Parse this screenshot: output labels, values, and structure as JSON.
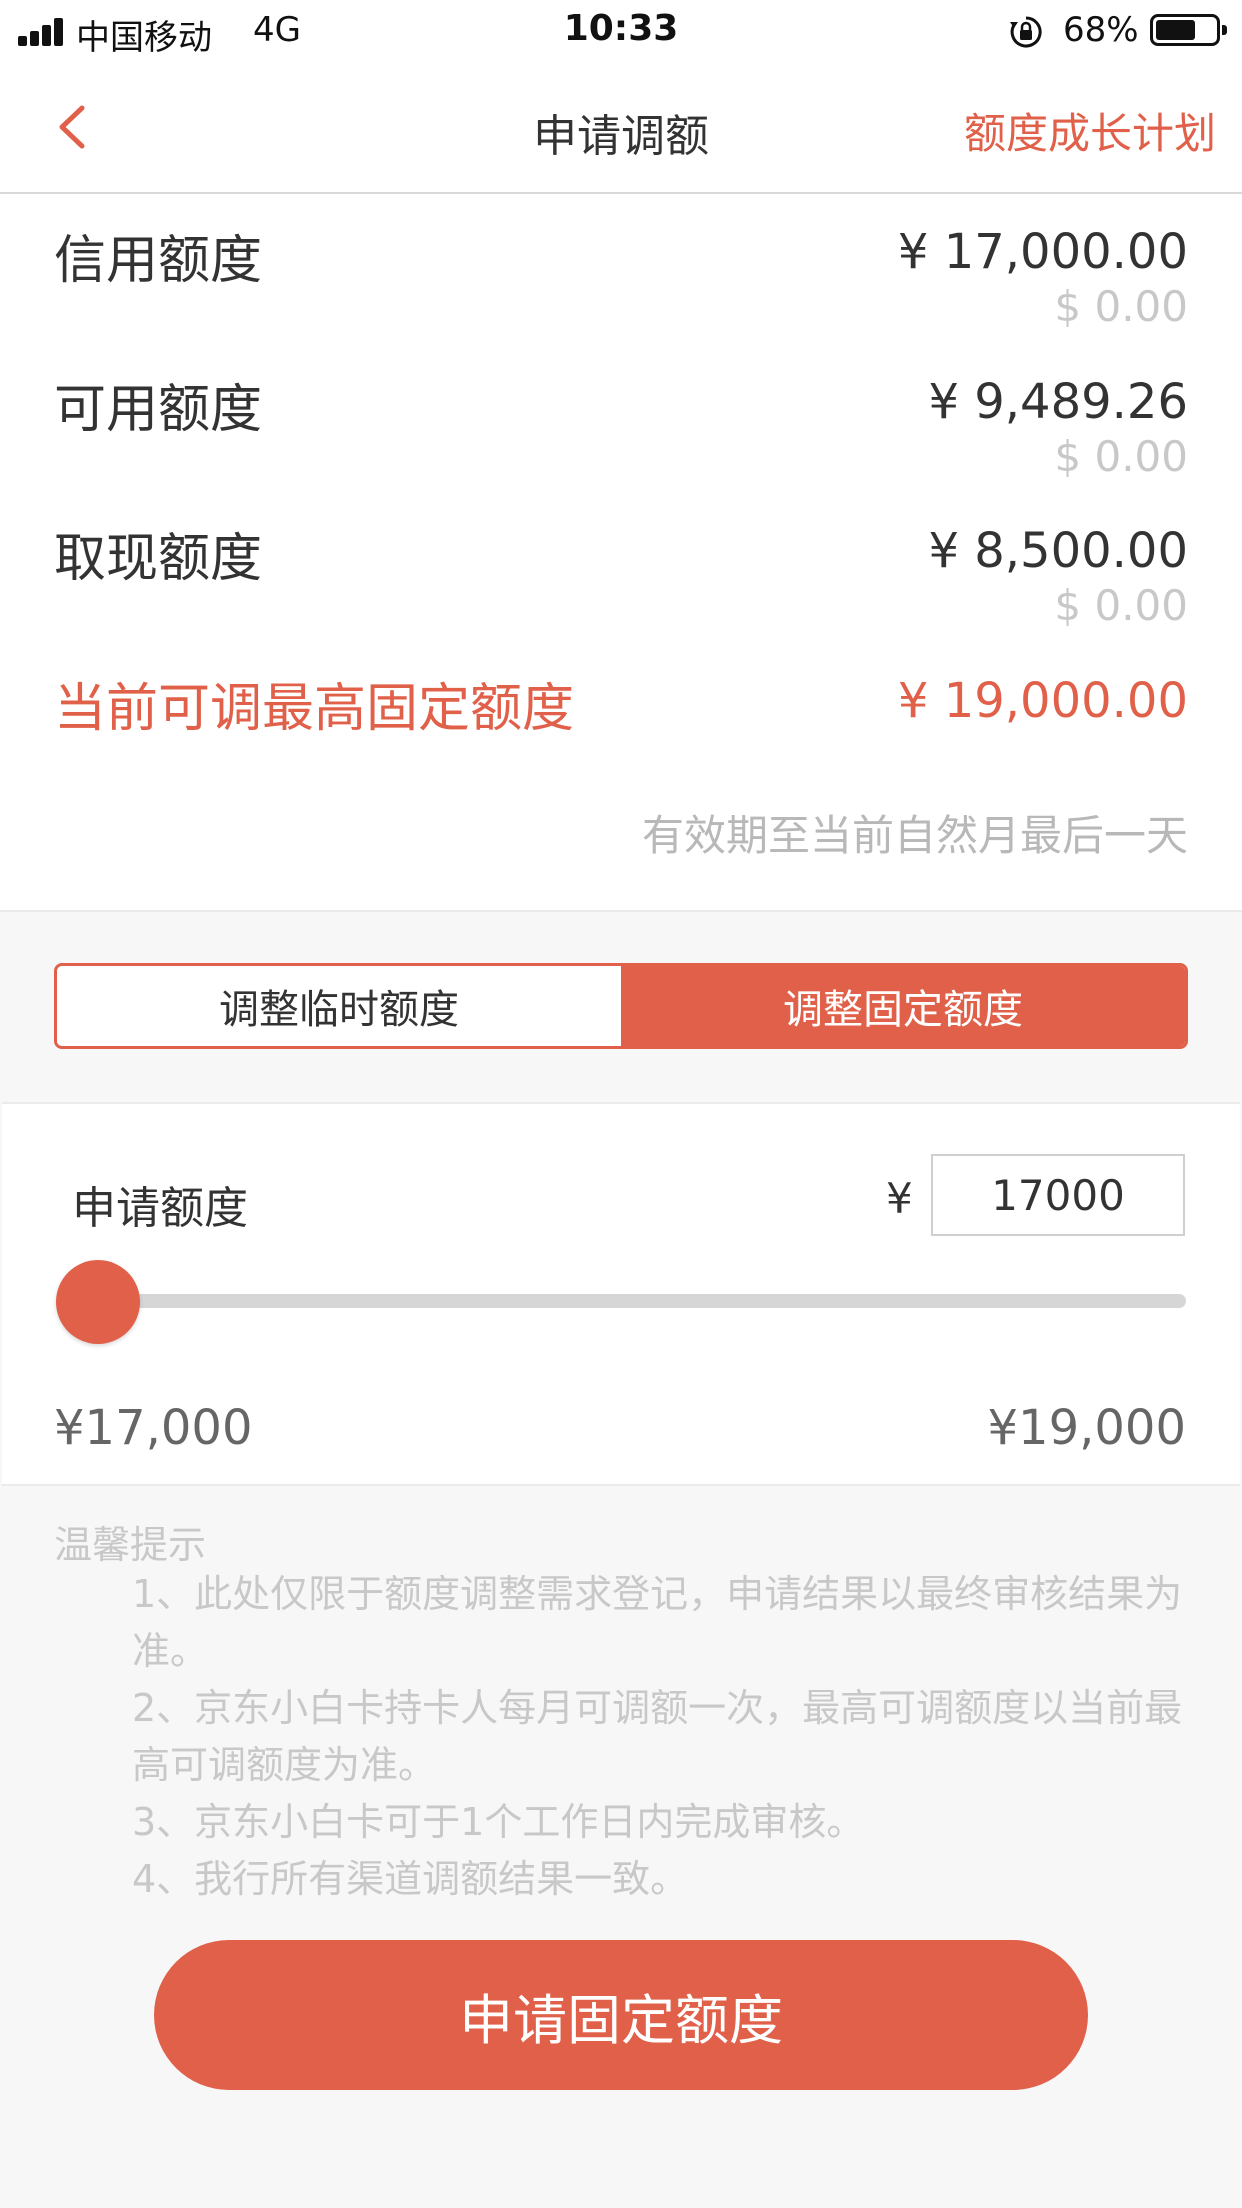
{
  "status_bar": {
    "carrier": "中国移动",
    "network": "4G",
    "time": "10:33",
    "battery_percent": "68%",
    "battery_level": 0.68
  },
  "nav": {
    "title": "申请调额",
    "action": "额度成长计划"
  },
  "credit_info": {
    "credit_limit": {
      "label": "信用额度",
      "cny": "¥ 17,000.00",
      "usd": "$ 0.00"
    },
    "available_limit": {
      "label": "可用额度",
      "cny": "¥ 9,489.26",
      "usd": "$ 0.00"
    },
    "cash_limit": {
      "label": "取现额度",
      "cny": "¥ 8,500.00",
      "usd": "$ 0.00"
    },
    "max_adjustable": {
      "label": "当前可调最高固定额度",
      "cny": "¥ 19,000.00"
    },
    "validity_note": "有效期至当前自然月最后一天"
  },
  "segment": {
    "temporary": "调整临时额度",
    "fixed": "调整固定额度",
    "selected": "fixed"
  },
  "apply": {
    "label": "申请额度",
    "currency": "¥",
    "amount": "17000",
    "slider_fraction": 0,
    "min_label": "¥17,000",
    "max_label": "¥19,000"
  },
  "tips": {
    "title": "温馨提示",
    "items": [
      "1、此处仅限于额度调整需求登记，申请结果以最终审核结果为准。",
      "2、京东小白卡持卡人每月可调额一次，最高可调额度以当前最高可调额度为准。",
      "3、京东小白卡可于1个工作日内完成审核。",
      "4、我行所有渠道调额结果一致。"
    ]
  },
  "submit_label": "申请固定额度",
  "colors": {
    "accent": "#e0604a",
    "text": "#333333",
    "muted": "#c8c8c8"
  },
  "icons": [
    "signal-icon",
    "orientation-lock-icon",
    "battery-icon",
    "back-chevron-icon"
  ]
}
